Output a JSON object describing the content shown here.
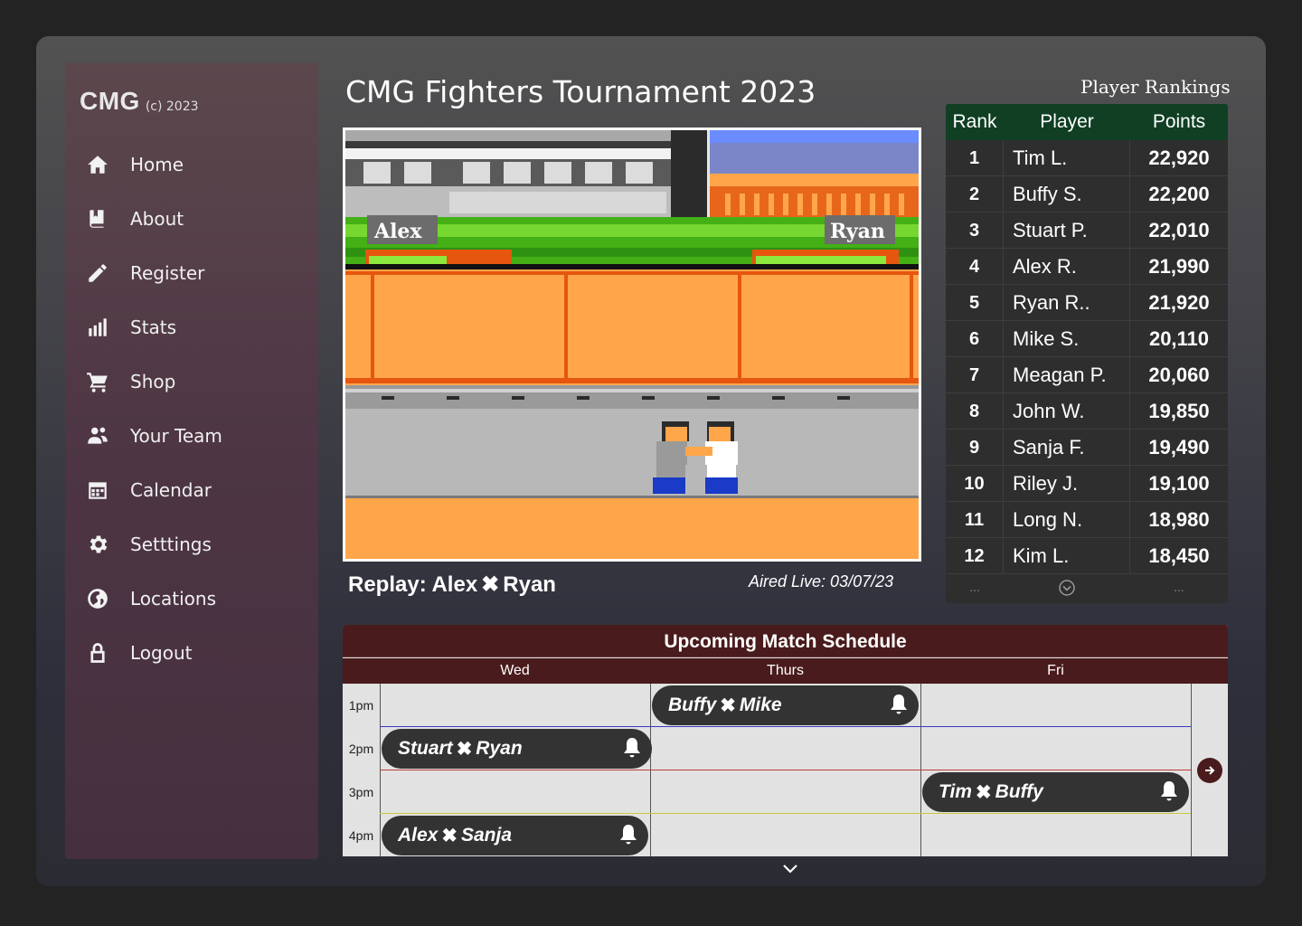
{
  "brand": {
    "logo": "CMG",
    "copyright": "(c) 2023"
  },
  "nav": [
    {
      "label": "Home",
      "icon": "home-icon"
    },
    {
      "label": "About",
      "icon": "book-icon"
    },
    {
      "label": "Register",
      "icon": "pencil-icon"
    },
    {
      "label": "Stats",
      "icon": "bar-chart-icon"
    },
    {
      "label": "Shop",
      "icon": "cart-icon"
    },
    {
      "label": "Your Team",
      "icon": "team-icon"
    },
    {
      "label": "Calendar",
      "icon": "calendar-icon"
    },
    {
      "label": "Setttings",
      "icon": "gear-icon"
    },
    {
      "label": "Locations",
      "icon": "globe-icon"
    },
    {
      "label": "Logout",
      "icon": "lock-icon"
    }
  ],
  "page": {
    "title": "CMG Fighters Tournament 2023"
  },
  "video": {
    "player1": "Alex",
    "player2": "Ryan",
    "replay_prefix": "Replay: Alex",
    "replay_suffix": "Ryan",
    "aired": "Aired Live: 03/07/23"
  },
  "rankings": {
    "title": "Player Rankings",
    "headers": {
      "rank": "Rank",
      "player": "Player",
      "points": "Points"
    },
    "rows": [
      {
        "rank": "1",
        "player": "Tim L.",
        "points": "22,920"
      },
      {
        "rank": "2",
        "player": "Buffy S.",
        "points": "22,200"
      },
      {
        "rank": "3",
        "player": "Stuart P.",
        "points": "22,010"
      },
      {
        "rank": "4",
        "player": "Alex R.",
        "points": "21,990"
      },
      {
        "rank": "5",
        "player": "Ryan R..",
        "points": "21,920"
      },
      {
        "rank": "6",
        "player": "Mike S.",
        "points": "20,110"
      },
      {
        "rank": "7",
        "player": "Meagan P.",
        "points": "20,060"
      },
      {
        "rank": "8",
        "player": "John W.",
        "points": "19,850"
      },
      {
        "rank": "9",
        "player": "Sanja F.",
        "points": "19,490"
      },
      {
        "rank": "10",
        "player": "Riley J.",
        "points": "19,100"
      },
      {
        "rank": "11",
        "player": "Long N.",
        "points": "18,980"
      },
      {
        "rank": "12",
        "player": "Kim L.",
        "points": "18,450"
      }
    ],
    "footer_ellipsis": "..."
  },
  "schedule": {
    "title": "Upcoming Match Schedule",
    "days": [
      "Wed",
      "Thurs",
      "Fri"
    ],
    "times": [
      "1pm",
      "2pm",
      "3pm",
      "4pm"
    ],
    "matches": [
      {
        "a": "Buffy",
        "b": "Mike"
      },
      {
        "a": "Stuart",
        "b": "Ryan"
      },
      {
        "a": "Tim",
        "b": "Buffy"
      },
      {
        "a": "Alex",
        "b": "Sanja"
      }
    ]
  }
}
